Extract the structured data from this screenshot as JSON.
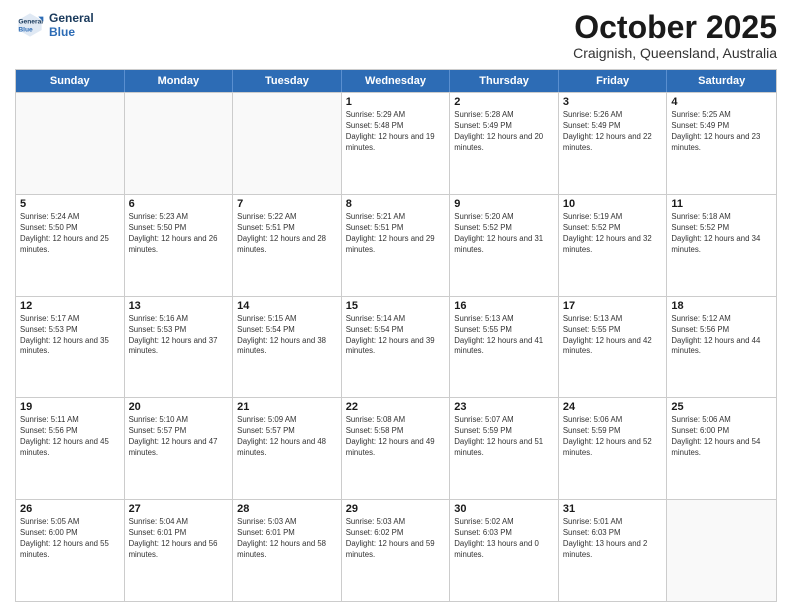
{
  "header": {
    "logo_line1": "General",
    "logo_line2": "Blue",
    "month": "October 2025",
    "location": "Craignish, Queensland, Australia"
  },
  "weekdays": [
    "Sunday",
    "Monday",
    "Tuesday",
    "Wednesday",
    "Thursday",
    "Friday",
    "Saturday"
  ],
  "weeks": [
    [
      {
        "day": "",
        "empty": true
      },
      {
        "day": "",
        "empty": true
      },
      {
        "day": "",
        "empty": true
      },
      {
        "day": "1",
        "sunrise": "5:29 AM",
        "sunset": "5:48 PM",
        "daylight": "12 hours and 19 minutes."
      },
      {
        "day": "2",
        "sunrise": "5:28 AM",
        "sunset": "5:49 PM",
        "daylight": "12 hours and 20 minutes."
      },
      {
        "day": "3",
        "sunrise": "5:26 AM",
        "sunset": "5:49 PM",
        "daylight": "12 hours and 22 minutes."
      },
      {
        "day": "4",
        "sunrise": "5:25 AM",
        "sunset": "5:49 PM",
        "daylight": "12 hours and 23 minutes."
      }
    ],
    [
      {
        "day": "5",
        "sunrise": "5:24 AM",
        "sunset": "5:50 PM",
        "daylight": "12 hours and 25 minutes."
      },
      {
        "day": "6",
        "sunrise": "5:23 AM",
        "sunset": "5:50 PM",
        "daylight": "12 hours and 26 minutes."
      },
      {
        "day": "7",
        "sunrise": "5:22 AM",
        "sunset": "5:51 PM",
        "daylight": "12 hours and 28 minutes."
      },
      {
        "day": "8",
        "sunrise": "5:21 AM",
        "sunset": "5:51 PM",
        "daylight": "12 hours and 29 minutes."
      },
      {
        "day": "9",
        "sunrise": "5:20 AM",
        "sunset": "5:52 PM",
        "daylight": "12 hours and 31 minutes."
      },
      {
        "day": "10",
        "sunrise": "5:19 AM",
        "sunset": "5:52 PM",
        "daylight": "12 hours and 32 minutes."
      },
      {
        "day": "11",
        "sunrise": "5:18 AM",
        "sunset": "5:52 PM",
        "daylight": "12 hours and 34 minutes."
      }
    ],
    [
      {
        "day": "12",
        "sunrise": "5:17 AM",
        "sunset": "5:53 PM",
        "daylight": "12 hours and 35 minutes."
      },
      {
        "day": "13",
        "sunrise": "5:16 AM",
        "sunset": "5:53 PM",
        "daylight": "12 hours and 37 minutes."
      },
      {
        "day": "14",
        "sunrise": "5:15 AM",
        "sunset": "5:54 PM",
        "daylight": "12 hours and 38 minutes."
      },
      {
        "day": "15",
        "sunrise": "5:14 AM",
        "sunset": "5:54 PM",
        "daylight": "12 hours and 39 minutes."
      },
      {
        "day": "16",
        "sunrise": "5:13 AM",
        "sunset": "5:55 PM",
        "daylight": "12 hours and 41 minutes."
      },
      {
        "day": "17",
        "sunrise": "5:13 AM",
        "sunset": "5:55 PM",
        "daylight": "12 hours and 42 minutes."
      },
      {
        "day": "18",
        "sunrise": "5:12 AM",
        "sunset": "5:56 PM",
        "daylight": "12 hours and 44 minutes."
      }
    ],
    [
      {
        "day": "19",
        "sunrise": "5:11 AM",
        "sunset": "5:56 PM",
        "daylight": "12 hours and 45 minutes."
      },
      {
        "day": "20",
        "sunrise": "5:10 AM",
        "sunset": "5:57 PM",
        "daylight": "12 hours and 47 minutes."
      },
      {
        "day": "21",
        "sunrise": "5:09 AM",
        "sunset": "5:57 PM",
        "daylight": "12 hours and 48 minutes."
      },
      {
        "day": "22",
        "sunrise": "5:08 AM",
        "sunset": "5:58 PM",
        "daylight": "12 hours and 49 minutes."
      },
      {
        "day": "23",
        "sunrise": "5:07 AM",
        "sunset": "5:59 PM",
        "daylight": "12 hours and 51 minutes."
      },
      {
        "day": "24",
        "sunrise": "5:06 AM",
        "sunset": "5:59 PM",
        "daylight": "12 hours and 52 minutes."
      },
      {
        "day": "25",
        "sunrise": "5:06 AM",
        "sunset": "6:00 PM",
        "daylight": "12 hours and 54 minutes."
      }
    ],
    [
      {
        "day": "26",
        "sunrise": "5:05 AM",
        "sunset": "6:00 PM",
        "daylight": "12 hours and 55 minutes."
      },
      {
        "day": "27",
        "sunrise": "5:04 AM",
        "sunset": "6:01 PM",
        "daylight": "12 hours and 56 minutes."
      },
      {
        "day": "28",
        "sunrise": "5:03 AM",
        "sunset": "6:01 PM",
        "daylight": "12 hours and 58 minutes."
      },
      {
        "day": "29",
        "sunrise": "5:03 AM",
        "sunset": "6:02 PM",
        "daylight": "12 hours and 59 minutes."
      },
      {
        "day": "30",
        "sunrise": "5:02 AM",
        "sunset": "6:03 PM",
        "daylight": "13 hours and 0 minutes."
      },
      {
        "day": "31",
        "sunrise": "5:01 AM",
        "sunset": "6:03 PM",
        "daylight": "13 hours and 2 minutes."
      },
      {
        "day": "",
        "empty": true
      }
    ]
  ]
}
